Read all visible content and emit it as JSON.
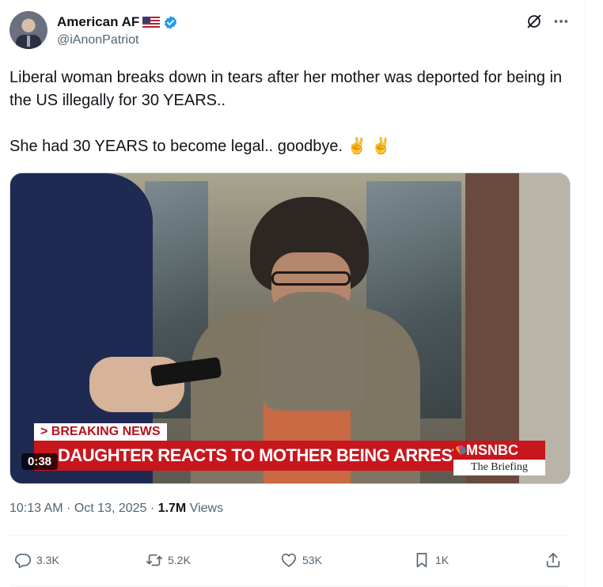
{
  "author": {
    "display_name": "American AF",
    "handle": "@iAnonPatriot"
  },
  "icons": {
    "flag": "us-flag-icon",
    "verified": "verified-badge-icon",
    "grok": "grok-icon",
    "more": "more-icon",
    "reply": "reply-icon",
    "retweet": "retweet-icon",
    "like": "like-icon",
    "bookmark": "bookmark-icon",
    "share": "share-icon"
  },
  "tweet": {
    "text": "Liberal woman breaks down in tears after her mother was deported for being in the US illegally for 30 YEARS..\n\nShe had 30 YEARS to become legal.. goodbye. ✌️ ✌️"
  },
  "media": {
    "breaking_label": "> BREAKING NEWS",
    "chyron": "DAUGHTER REACTS TO MOTHER BEING ARRESTED BY ICE",
    "network": "MSNBC",
    "program": "The Briefing",
    "duration": "0:38"
  },
  "meta": {
    "time": "10:13 AM",
    "separator": " · ",
    "date": "Oct 13, 2025",
    "views_count": "1.7M",
    "views_label": " Views"
  },
  "actions": {
    "replies": "3.3K",
    "reposts": "5.2K",
    "likes": "53K",
    "bookmarks": "1K"
  },
  "colors": {
    "verified_blue": "#1d9bf0",
    "text_primary": "#0f1419",
    "text_secondary": "#536471",
    "msnbc_red": "#c8161d"
  }
}
